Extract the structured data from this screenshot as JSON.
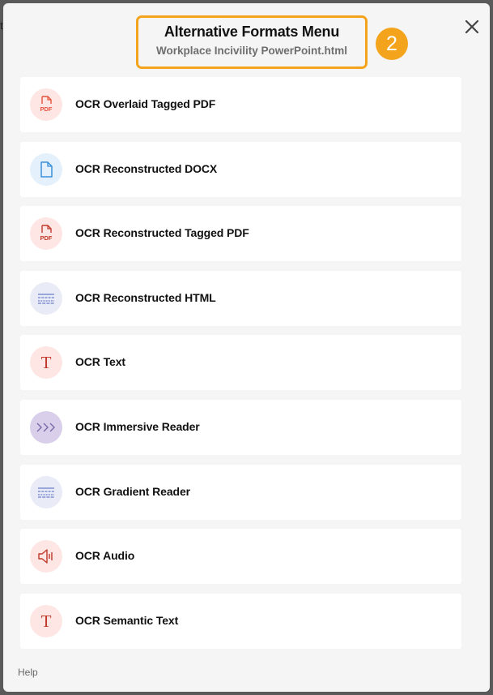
{
  "backdrop": {
    "fragment": "t"
  },
  "dialog": {
    "title": "Alternative Formats Menu",
    "subtitle": "Workplace Incivility PowerPoint.html",
    "step_badge": "2",
    "close_label": "×"
  },
  "colors": {
    "highlight": "#f4a41c",
    "pdf_icon": "#e5533d",
    "docx_icon": "#3b8fd9",
    "text_icon": "#c0392b",
    "html_icon": "#6a7ec9",
    "reader_icon": "#7a6aa8"
  },
  "formats": [
    {
      "label": "OCR Overlaid Tagged PDF",
      "icon": "pdf-icon",
      "icon_text": "PDF"
    },
    {
      "label": "OCR Reconstructed DOCX",
      "icon": "document-icon",
      "icon_text": ""
    },
    {
      "label": "OCR Reconstructed Tagged PDF",
      "icon": "pdf-icon",
      "icon_text": "PDF"
    },
    {
      "label": "OCR Reconstructed HTML",
      "icon": "html-lines-icon",
      "icon_text": ""
    },
    {
      "label": "OCR Text",
      "icon": "text-t-icon",
      "icon_text": "T"
    },
    {
      "label": "OCR Immersive Reader",
      "icon": "chevrons-icon",
      "icon_text": ""
    },
    {
      "label": "OCR Gradient Reader",
      "icon": "gradient-lines-icon",
      "icon_text": ""
    },
    {
      "label": "OCR Audio",
      "icon": "speaker-icon",
      "icon_text": ""
    },
    {
      "label": "OCR Semantic Text",
      "icon": "text-t-icon",
      "icon_text": "T"
    }
  ],
  "footer": {
    "help_label": "Help"
  }
}
